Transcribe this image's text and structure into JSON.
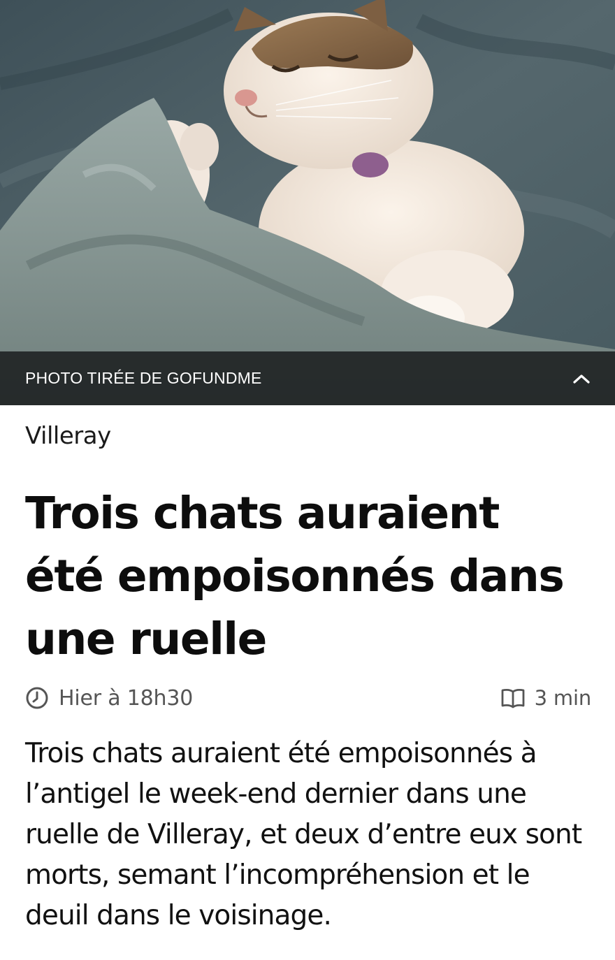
{
  "hero": {
    "image_subject": "cat-under-blanket-photo",
    "caption": "PHOTO TIRÉE DE GOFUNDME",
    "toggle_icon": "chevron-up-icon"
  },
  "article": {
    "section": "Villeray",
    "headline": "Trois chats auraient été empoisonnés dans une ruelle",
    "published": "Hier à 18h30",
    "published_icon": "clock-icon",
    "read_time": "3 min",
    "read_time_icon": "book-icon",
    "lead": "Trois chats auraient été empoisonnés à l’antigel le week-end dernier dans une ruelle de Villeray, et deux d’entre eux sont morts, semant l’incompréhension et le deuil dans le voisinage."
  },
  "colors": {
    "caption_bg": "#16181a",
    "meta_text": "#555555",
    "body_text": "#111111"
  }
}
